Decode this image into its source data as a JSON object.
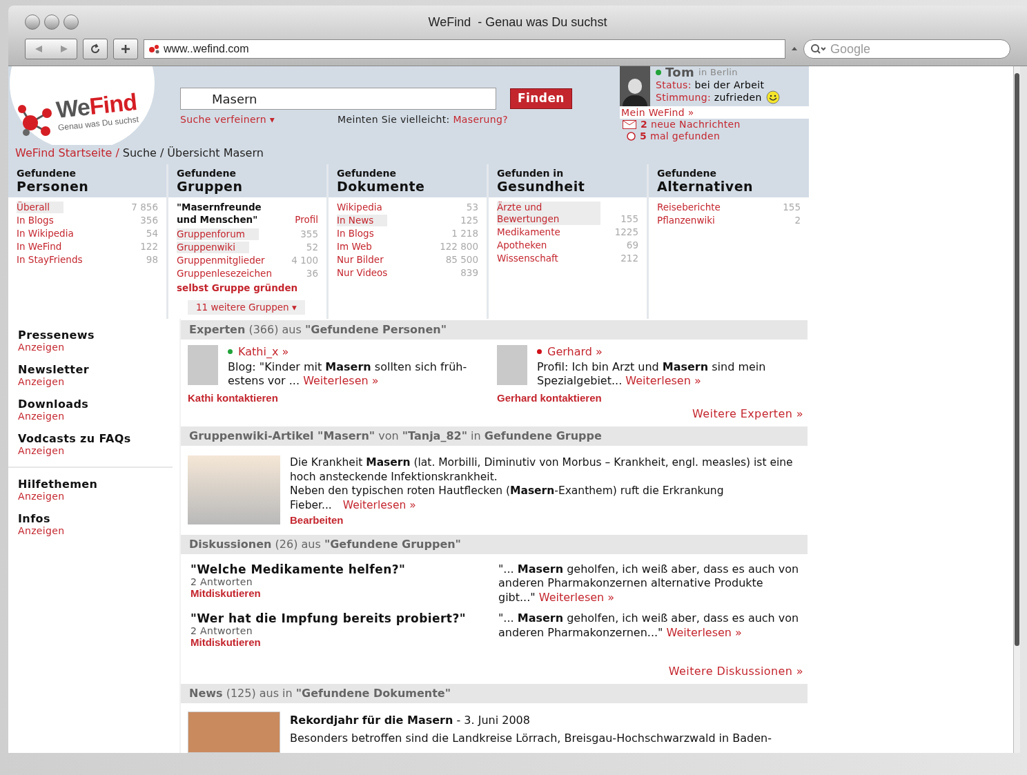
{
  "window": {
    "title": "WeFind  - Genau was Du suchst"
  },
  "toolbar": {
    "url": "www..wefind.com",
    "search_placeholder": "Google"
  },
  "logo": {
    "parts": [
      "We",
      "Find"
    ],
    "tagline": "Genau was Du suchst"
  },
  "search": {
    "value": "Masern",
    "button": "Finden",
    "refine": "Suche verfeinern",
    "refine_caret": "▾",
    "suggestion_prefix": "Meinten Sie vielleicht:",
    "suggestion": "Maserung?"
  },
  "user": {
    "name": "Tom",
    "location": "in Berlin",
    "online": true,
    "status_label": "Status:",
    "status": "bei der Arbeit",
    "mood_label": "Stimmung:",
    "mood": "zufrieden",
    "link": "Mein WeFind »",
    "messages_count": "2",
    "messages": "neue Nachrichten",
    "found_count": "5",
    "found": "mal gefunden"
  },
  "breadcrumb": {
    "separator": "/",
    "items": [
      {
        "label": "WeFind Startseite",
        "kind": "link"
      },
      {
        "label": "Suche",
        "kind": "text"
      },
      {
        "label": "Übersicht Masern",
        "kind": "text"
      }
    ]
  },
  "columns": [
    {
      "heading_small": "Gefundene",
      "heading": "Personen",
      "items": [
        {
          "label": "Überall",
          "count": "7 856",
          "highlighted": true
        },
        {
          "label": "In Blogs",
          "count": "356",
          "highlighted": false
        },
        {
          "label": "In Wikipedia",
          "count": "54",
          "highlighted": false
        },
        {
          "label": "In WeFind",
          "count": "122",
          "highlighted": false
        },
        {
          "label": "In StayFriends",
          "count": "98",
          "highlighted": false
        }
      ]
    },
    {
      "heading_small": "Gefundene",
      "heading": "Gruppen",
      "featured": {
        "title": "\"Masernfreunde und Menschen\"",
        "link": "Profil"
      },
      "items": [
        {
          "label": "Gruppenforum",
          "count": "355",
          "highlighted": true
        },
        {
          "label": "Gruppenwiki",
          "count": "52",
          "highlighted": true
        },
        {
          "label": "Gruppenmitglieder",
          "count": "4 100",
          "highlighted": false
        },
        {
          "label": "Gruppenlesezeichen",
          "count": "36",
          "highlighted": false
        }
      ],
      "action": "selbst Gruppe gründen",
      "more": "11 weitere Gruppen",
      "more_caret": "▾"
    },
    {
      "heading_small": "Gefundene",
      "heading": "Dokumente",
      "items": [
        {
          "label": "Wikipedia",
          "count": "53",
          "highlighted": false
        },
        {
          "label": "In News",
          "count": "125",
          "highlighted": true
        },
        {
          "label": "In Blogs",
          "count": "1 218",
          "highlighted": false
        },
        {
          "label": "Im Web",
          "count": "122 800",
          "highlighted": false
        },
        {
          "label": "Nur Bilder",
          "count": "85 500",
          "highlighted": false
        },
        {
          "label": "Nur Videos",
          "count": "839",
          "highlighted": false
        }
      ]
    },
    {
      "heading_small": "Gefunden in",
      "heading": "Gesundheit",
      "items": [
        {
          "label": "Ärzte und Bewertungen",
          "count": "155",
          "highlighted": true
        },
        {
          "label": "Medikamente",
          "count": "1225",
          "highlighted": false
        },
        {
          "label": "Apotheken",
          "count": "69",
          "highlighted": false
        },
        {
          "label": "Wissenschaft",
          "count": "212",
          "highlighted": false
        }
      ]
    },
    {
      "heading_small": "Gefundene",
      "heading": "Alternativen",
      "items": [
        {
          "label": "Reiseberichte",
          "count": "155",
          "highlighted": false
        },
        {
          "label": "Pflanzenwiki",
          "count": "2",
          "highlighted": false
        }
      ]
    }
  ],
  "sidebar": [
    [
      {
        "title": "Pressenews",
        "link": "Anzeigen"
      },
      {
        "title": "Newsletter",
        "link": "Anzeigen"
      },
      {
        "title": "Downloads",
        "link": "Anzeigen"
      },
      {
        "title": "Vodcasts zu FAQs",
        "link": "Anzeigen"
      }
    ],
    [
      {
        "title": "Hilfethemen",
        "link": "Anzeigen"
      },
      {
        "title": "Infos",
        "link": "Anzeigen"
      }
    ]
  ],
  "experts": {
    "header": "**Experten** (366) aus **\"Gefundene Personen\"**",
    "items": [
      {
        "name": "Kathi_x »",
        "color": "#22a33a",
        "text": "Blog: \"Kinder mit **Masern** sollten sich früh-estens vor ...",
        "read_more": "Weiterlesen »",
        "contact": "Kathi kontaktieren"
      },
      {
        "name": "Gerhard »",
        "color": "#d0101a",
        "text": "Profil: Ich bin Arzt und **Masern** sind mein Spezialgebiet...",
        "read_more": "Weiterlesen »",
        "contact": "Gerhard kontaktieren"
      }
    ],
    "more": "Weitere Experten »"
  },
  "wiki": {
    "header": "**Gruppenwiki-Artikel \"Masern\"** von **\"Tanja_82\"** in **Gefundene Gruppe**",
    "paragraphs": [
      "Die Krankheit **Masern** (lat. Morbilli, Diminutiv von Morbus – Krankheit, engl. measles) ist eine hoch ansteckende Infektionskrankheit.",
      "Neben den typischen roten Hautflecken (**Masern**-Exanthem) ruft die Erkrankung Fieber..."
    ],
    "read_more": "Weiterlesen »",
    "edit": "Bearbeiten"
  },
  "discussions": {
    "header": "**Diskussionen** (26) aus **\"Gefundene Gruppen\"**",
    "items": [
      {
        "title": "\"Welche Medikamente helfen?\"",
        "answers": "2 Antworten",
        "action": "Mitdiskutieren",
        "excerpt": "\"... **Masern** geholfen, ich weiß aber, dass es auch von anderen Pharmakonzernen alternative Produkte gibt...\"",
        "read_more": "Weiterlesen »"
      },
      {
        "title": "\"Wer hat die Impfung bereits probiert?\"",
        "answers": "2 Antworten",
        "action": "Mitdiskutieren",
        "excerpt": "\"... **Masern** geholfen, ich weiß aber, dass es auch von anderen Pharmakonzernen...\"",
        "read_more": "Weiterlesen »"
      }
    ],
    "more": "Weitere Diskussionen »"
  },
  "news": {
    "header": "**News** (125) aus in **\"Gefundene Dokumente\"**",
    "items": [
      {
        "title": "Rekordjahr für die Masern",
        "date": "- 3. Juni 2008",
        "text": "Besonders betroffen sind die Landkreise Lörrach, Breisgau-Hochschwarzwald in Baden-"
      }
    ]
  }
}
